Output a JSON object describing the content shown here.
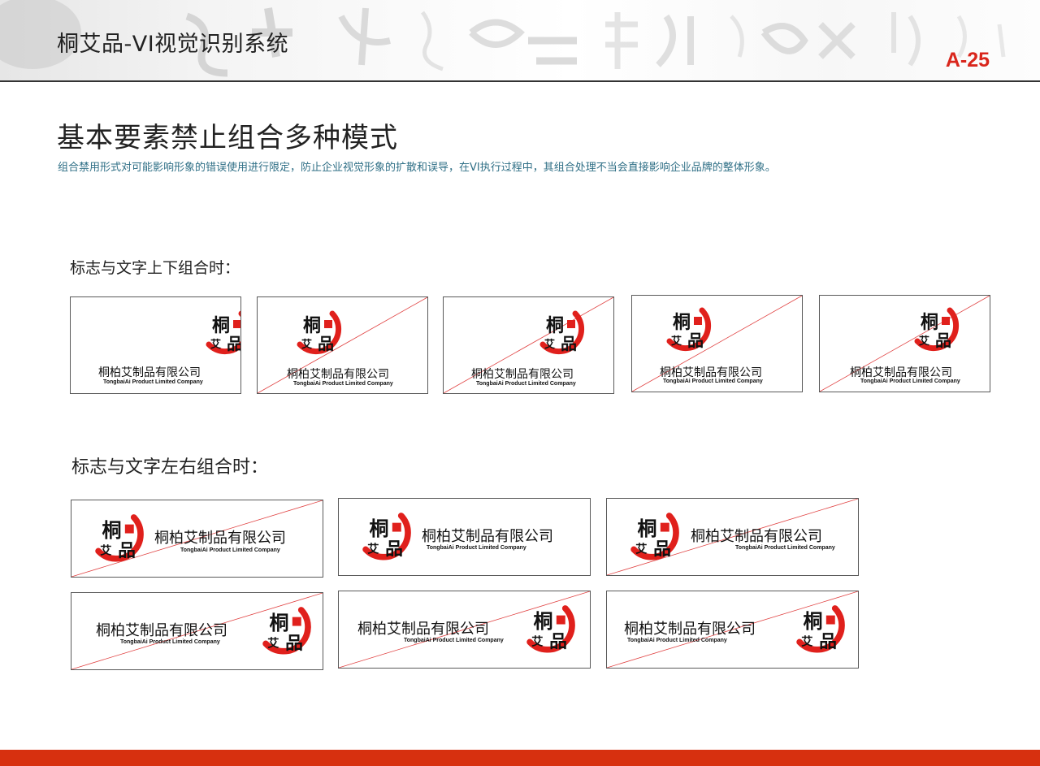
{
  "header": {
    "title": "桐艾品-VI视觉识别系统",
    "page_number": "A-25"
  },
  "main": {
    "title": "基本要素禁止组合多种模式",
    "subtitle": "组合禁用形式对可能影响形象的错误使用进行限定，防止企业视觉形象的扩散和误导，在VI执行过程中，其组合处理不当会直接影响企业品牌的整体形象。"
  },
  "sections": {
    "vertical_label": "标志与文字上下组合时：",
    "horizontal_label": "标志与文字左右组合时："
  },
  "brand": {
    "company_cn": "桐柏艾制品有限公司",
    "company_en": "TongbaiAi Product Limited Company",
    "logo_chars": [
      "桐",
      "艾",
      "品"
    ],
    "logo_color": "#e0201c",
    "cross_color": "#e04040"
  }
}
